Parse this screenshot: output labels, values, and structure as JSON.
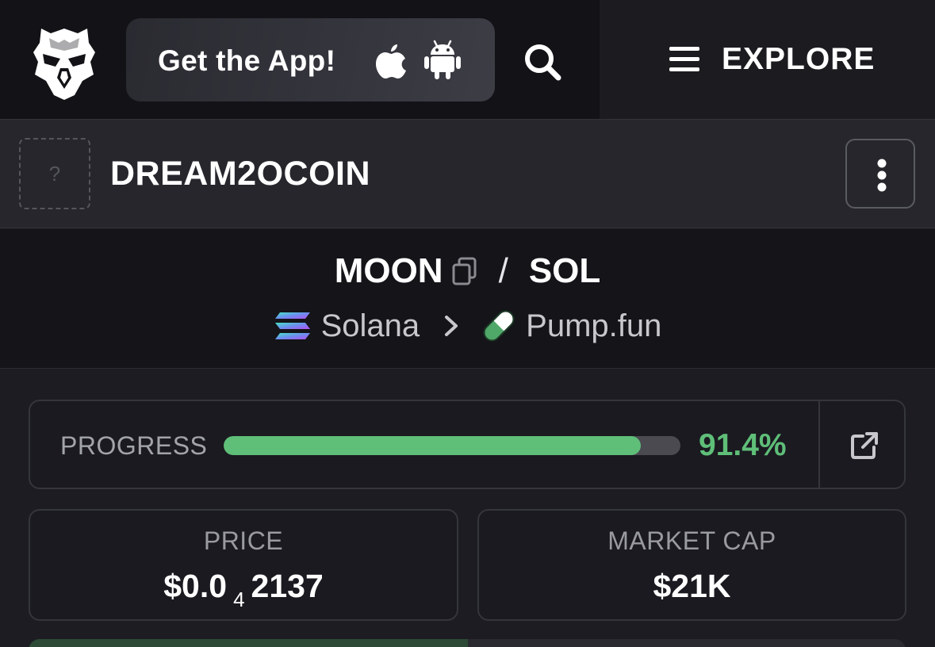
{
  "topbar": {
    "get_app_label": "Get the App!",
    "explore_label": "EXPLORE",
    "icons": {
      "logo": "eagle-logo-icon",
      "apple": "apple-icon",
      "android": "android-icon",
      "search": "search-icon",
      "menu": "hamburger-icon"
    }
  },
  "token": {
    "avatar_placeholder": "?",
    "name": "DREAM2OCOIN"
  },
  "pair": {
    "base": "MOON",
    "separator": "/",
    "quote": "SOL",
    "chain": "Solana",
    "dex": "Pump.fun"
  },
  "progress": {
    "label": "PROGRESS",
    "percent": 91.4,
    "value_text": "91.4%"
  },
  "stats": {
    "price_label": "PRICE",
    "price_prefix": "$0.0",
    "price_zero_count": "4",
    "price_digits": "2137",
    "market_cap_label": "MARKET CAP",
    "market_cap_value": "$21K"
  },
  "colors": {
    "accent_green": "#5fbe78",
    "background": "#1c1c22",
    "topbar": "#121217"
  }
}
